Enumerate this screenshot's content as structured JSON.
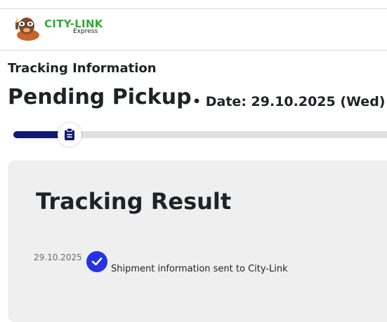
{
  "header": {
    "brand_name": "CITY-LINK",
    "brand_sub": "Express",
    "brand_color": "#37a63c",
    "mascot_icon": "dog-mascot-icon"
  },
  "tracking": {
    "heading": "Tracking Information",
    "status": "Pending Pickup",
    "date_text": "• Date: 29.10.2025 (Wed)",
    "progress_fraction": 0.16,
    "progress_icon": "clipboard-icon",
    "progress_color": "#0f1a7a"
  },
  "result": {
    "title": "Tracking Result",
    "events": [
      {
        "date": "29.10.2025",
        "description": "Shipment information sent to City-Link",
        "icon": "check-icon",
        "icon_color": "#2532e6"
      }
    ]
  }
}
